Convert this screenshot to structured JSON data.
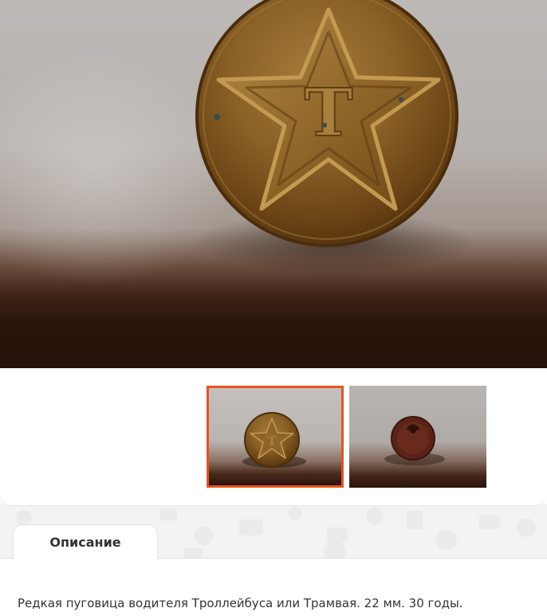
{
  "gallery": {
    "main_image": {
      "subject": "button-photo",
      "emblem_letter": "Т"
    },
    "thumbnails": [
      {
        "subject": "button-front-thumbnail",
        "emblem_letter": "Т",
        "selected": true
      },
      {
        "subject": "button-back-thumbnail",
        "selected": false
      }
    ],
    "accent_color": "#e8541f"
  },
  "tabs": [
    {
      "label": "Описание",
      "active": true
    }
  ],
  "description": {
    "text": "Редкая пуговица водителя Троллейбуса или Трамвая. 22 мм. 30 годы."
  }
}
